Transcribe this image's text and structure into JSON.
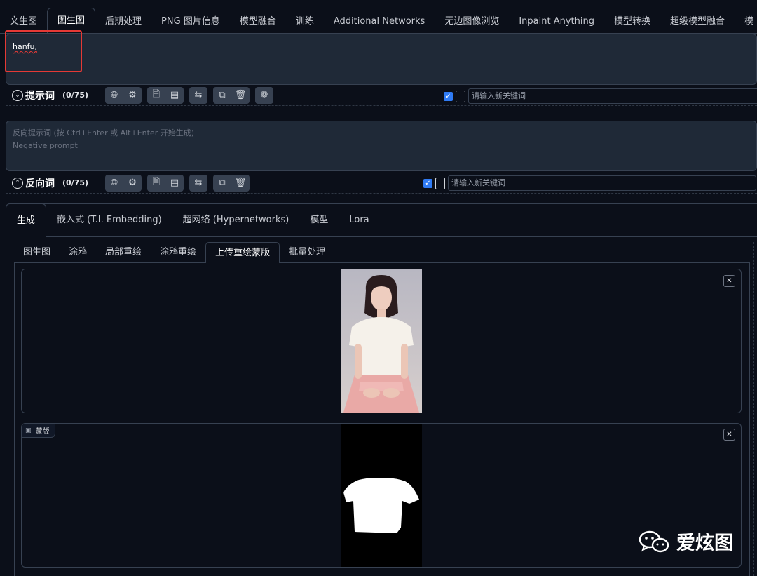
{
  "top_tabs": [
    "文生图",
    "图生图",
    "后期处理",
    "PNG 图片信息",
    "模型融合",
    "训练",
    "Additional Networks",
    "无边图像浏览",
    "Inpaint Anything",
    "模型转换",
    "超级模型融合",
    "模"
  ],
  "prompt": {
    "value": "hanfu,",
    "section_label": "提示词",
    "token_count": "(0/75)",
    "keyword_placeholder": "请输入新关键词"
  },
  "negative_prompt": {
    "placeholder_line1": "反向提示词 (按 Ctrl+Enter 或 Alt+Enter 开始生成)",
    "placeholder_line2": "Negative prompt",
    "section_label": "反向词",
    "token_count": "(0/75)",
    "keyword_placeholder": "请输入新关键词"
  },
  "main_tabs": [
    "生成",
    "嵌入式 (T.I. Embedding)",
    "超网络 (Hypernetworks)",
    "模型",
    "Lora"
  ],
  "sub_tabs": [
    "图生图",
    "涂鸦",
    "局部重绘",
    "涂鸦重绘",
    "上传重绘蒙版",
    "批量处理"
  ],
  "mask_panel": {
    "label": "蒙版"
  },
  "watermark": {
    "text": "爱炫图"
  },
  "colors": {
    "background": "#0b0f19",
    "panel": "#1f2937",
    "accent_checkbox": "#2f7bf5",
    "highlight": "#e53935"
  }
}
